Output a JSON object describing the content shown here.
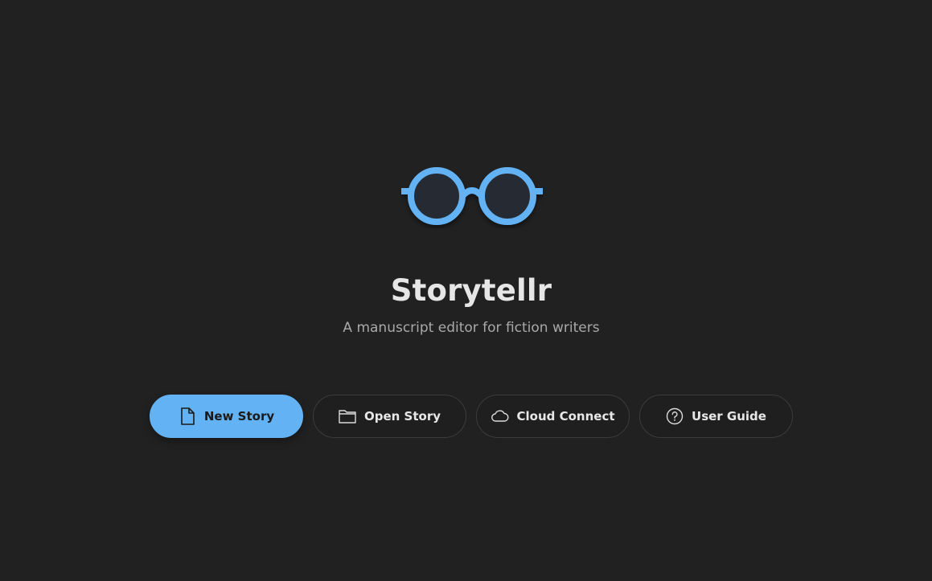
{
  "app": {
    "title": "Storytellr",
    "subtitle": "A manuscript editor for fiction writers",
    "logo_icon": "glasses-icon",
    "accent_color": "#63b3f4",
    "background_color": "#212121"
  },
  "actions": [
    {
      "label": "New Story",
      "icon": "file-icon",
      "primary": true
    },
    {
      "label": "Open Story",
      "icon": "folder-icon",
      "primary": false
    },
    {
      "label": "Cloud Connect",
      "icon": "cloud-icon",
      "primary": false
    },
    {
      "label": "User Guide",
      "icon": "help-circle-icon",
      "primary": false
    }
  ]
}
